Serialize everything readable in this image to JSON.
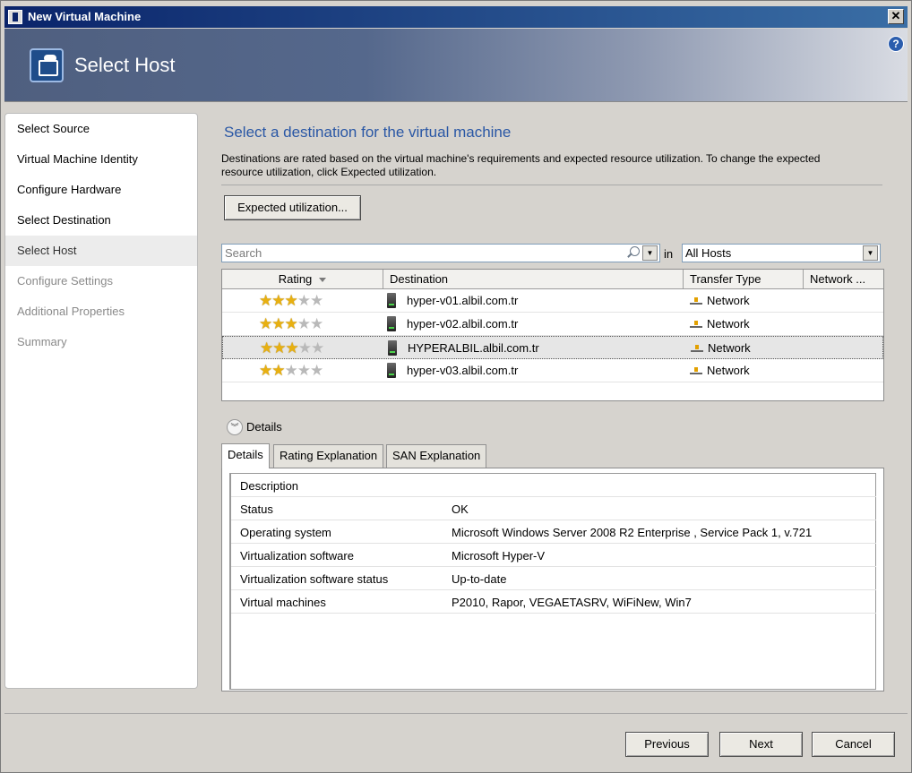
{
  "window": {
    "title": "New Virtual Machine"
  },
  "header": {
    "page_title": "Select Host",
    "help_icon": "?",
    "close_label": "✕"
  },
  "nav": {
    "items": [
      {
        "label": "Select Source",
        "state": "done"
      },
      {
        "label": "Virtual Machine Identity",
        "state": "done"
      },
      {
        "label": "Configure Hardware",
        "state": "done"
      },
      {
        "label": "Select Destination",
        "state": "done"
      },
      {
        "label": "Select Host",
        "state": "current"
      },
      {
        "label": "Configure Settings",
        "state": "disabled"
      },
      {
        "label": "Additional Properties",
        "state": "disabled"
      },
      {
        "label": "Summary",
        "state": "disabled"
      }
    ]
  },
  "main": {
    "heading": "Select a destination for the virtual machine",
    "description": "Destinations are rated based on the virtual machine's requirements and expected resource utilization.  To change the expected resource utilization, click Expected utilization.",
    "expected_button": "Expected utilization...",
    "search": {
      "placeholder": "Search",
      "in_label": "in",
      "scope": "All Hosts"
    },
    "grid": {
      "columns": [
        "Rating",
        "Destination",
        "Transfer Type",
        "Network ..."
      ],
      "rows": [
        {
          "stars": 3,
          "destination": "hyper-v01.albil.com.tr",
          "transfer": "Network"
        },
        {
          "stars": 3,
          "destination": "hyper-v02.albil.com.tr",
          "transfer": "Network"
        },
        {
          "stars": 3,
          "destination": "HYPERALBIL.albil.com.tr",
          "transfer": "Network",
          "selected": true
        },
        {
          "stars": 2,
          "destination": "hyper-v03.albil.com.tr",
          "transfer": "Network"
        }
      ]
    },
    "details": {
      "toggle_label": "Details",
      "tabs": [
        "Details",
        "Rating Explanation",
        "SAN Explanation"
      ],
      "section_title": "Description",
      "properties": [
        {
          "key": "Status",
          "value": "OK"
        },
        {
          "key": "Operating system",
          "value": "Microsoft Windows Server 2008 R2 Enterprise , Service Pack 1, v.721"
        },
        {
          "key": "Virtualization software",
          "value": "Microsoft Hyper-V"
        },
        {
          "key": "Virtualization software status",
          "value": "Up-to-date"
        },
        {
          "key": "Virtual machines",
          "value": "P2010, Rapor, VEGAETASRV, WiFiNew, Win7"
        }
      ]
    }
  },
  "footer": {
    "previous": "Previous",
    "next": "Next",
    "cancel": "Cancel"
  },
  "colors": {
    "heading": "#2a57a5",
    "star_on": "#e8b010",
    "star_off": "#b9b9b9"
  }
}
